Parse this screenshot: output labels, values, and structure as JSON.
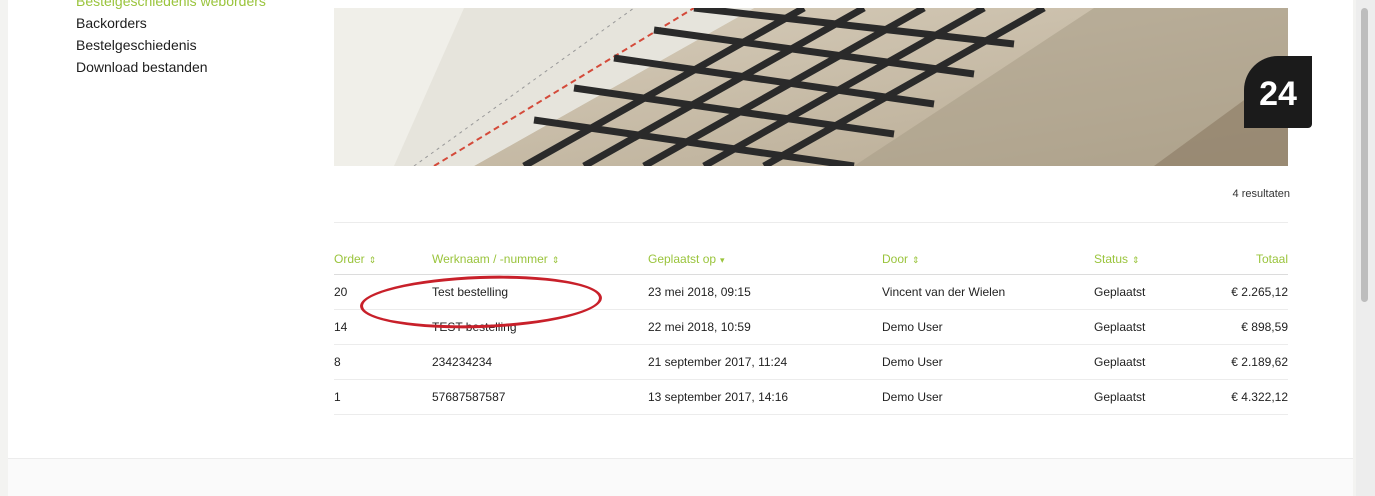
{
  "sidebar": {
    "items": [
      {
        "label": "Bestelgeschiedenis weborders"
      },
      {
        "label": "Backorders"
      },
      {
        "label": "Bestelgeschiedenis"
      },
      {
        "label": "Download bestanden"
      }
    ]
  },
  "badge": {
    "number": "24"
  },
  "results": {
    "count_label": "4 resultaten"
  },
  "table": {
    "headers": {
      "order": "Order",
      "werknaam": "Werknaam / -nummer",
      "geplaatst": "Geplaatst op",
      "door": "Door",
      "status": "Status",
      "totaal": "Totaal"
    },
    "rows": [
      {
        "order": "20",
        "werknaam": "Test bestelling",
        "geplaatst": "23 mei 2018, 09:15",
        "door": "Vincent van der Wielen",
        "status": "Geplaatst",
        "totaal": "€ 2.265,12"
      },
      {
        "order": "14",
        "werknaam": "TEST bestelling",
        "geplaatst": "22 mei 2018, 10:59",
        "door": "Demo User",
        "status": "Geplaatst",
        "totaal": "€ 898,59"
      },
      {
        "order": "8",
        "werknaam": "234234234",
        "geplaatst": "21 september 2017, 11:24",
        "door": "Demo User",
        "status": "Geplaatst",
        "totaal": "€ 2.189,62"
      },
      {
        "order": "1",
        "werknaam": "57687587587",
        "geplaatst": "13 september 2017, 14:16",
        "door": "Demo User",
        "status": "Geplaatst",
        "totaal": "€ 4.322,12"
      }
    ]
  },
  "colors": {
    "accent": "#9ac43c",
    "highlight_circle": "#c8202a",
    "badge_bg": "#1b1b1b"
  },
  "icons": {
    "sort": "sort-icon",
    "sort_active": "sort-down-icon"
  }
}
